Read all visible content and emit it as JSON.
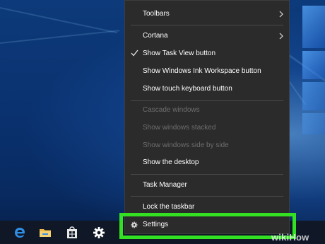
{
  "menu": {
    "items": [
      {
        "label": "Toolbars",
        "submenu": true
      },
      {
        "label": "Cortana",
        "submenu": true
      },
      {
        "label": "Show Task View button",
        "checked": true
      },
      {
        "label": "Show Windows Ink Workspace button"
      },
      {
        "label": "Show touch keyboard button"
      },
      {
        "label": "Cascade windows",
        "disabled": true
      },
      {
        "label": "Show windows stacked",
        "disabled": true
      },
      {
        "label": "Show windows side by side",
        "disabled": true
      },
      {
        "label": "Show the desktop"
      },
      {
        "label": "Task Manager"
      },
      {
        "label": "Lock the taskbar"
      },
      {
        "label": "Settings",
        "icon": "gear-icon"
      }
    ]
  },
  "taskbar": {
    "icons": [
      "edge-icon",
      "file-explorer-icon",
      "store-icon",
      "settings-gear-icon"
    ]
  },
  "watermark": {
    "text_a": "wiki",
    "text_b": "How"
  },
  "colors": {
    "menu_bg": "#2b2b2b",
    "highlight": "#33e022",
    "taskbar_bg": "#101828",
    "edge_blue": "#2f8fe6",
    "folder_yellow": "#e9b949"
  }
}
